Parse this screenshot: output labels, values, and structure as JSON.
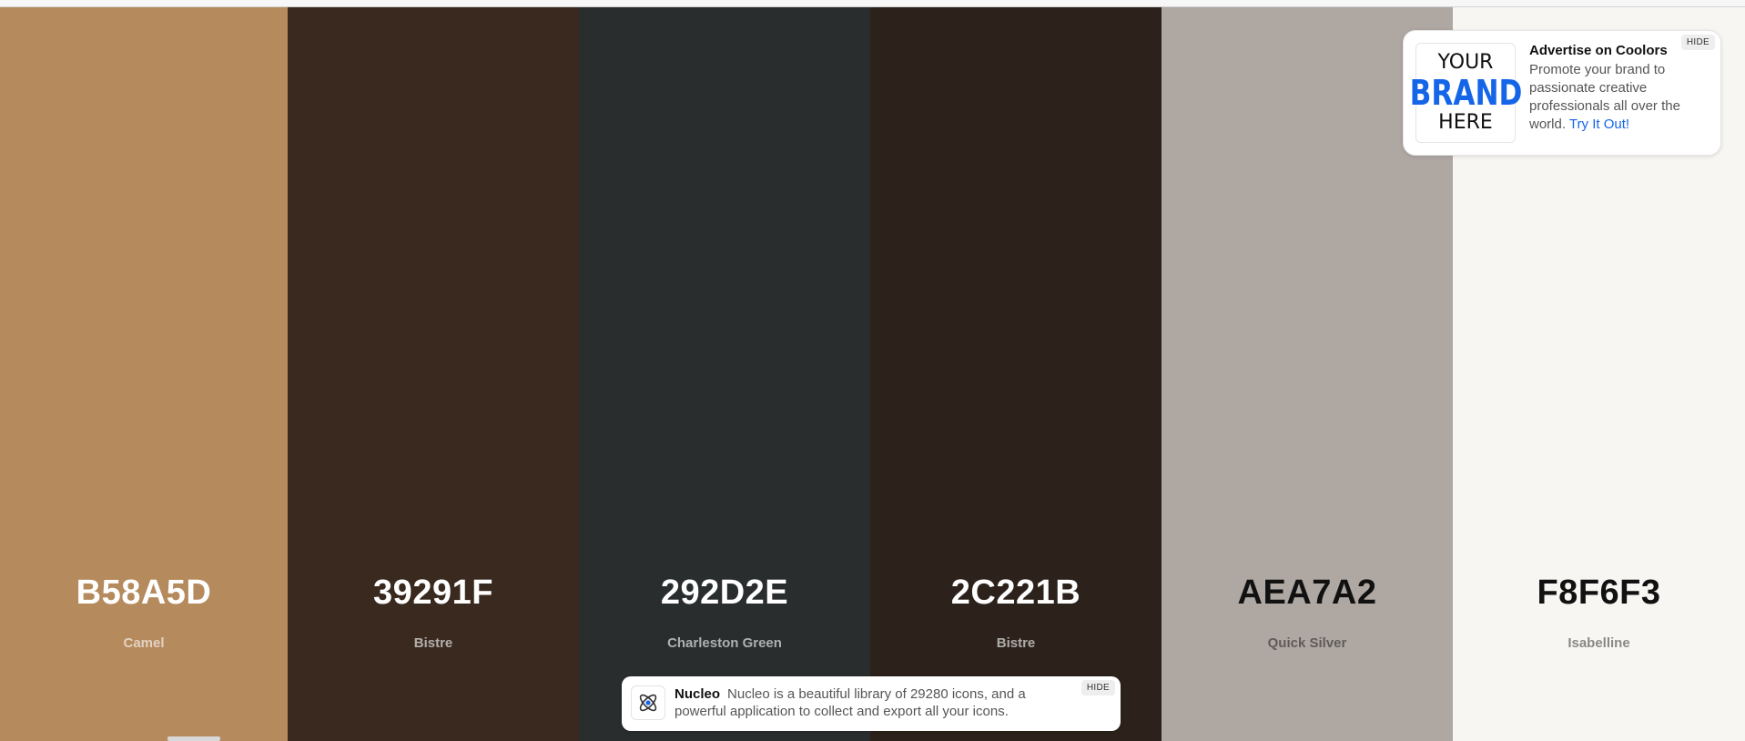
{
  "palette": {
    "colors": [
      {
        "hex": "B58A5D",
        "name": "Camel",
        "color": "#B58A5D",
        "text_theme": "light"
      },
      {
        "hex": "39291F",
        "name": "Bistre",
        "color": "#39291F",
        "text_theme": "light"
      },
      {
        "hex": "292D2E",
        "name": "Charleston Green",
        "color": "#292D2E",
        "text_theme": "light"
      },
      {
        "hex": "2C221B",
        "name": "Bistre",
        "color": "#2C221B",
        "text_theme": "light"
      },
      {
        "hex": "AEA7A2",
        "name": "Quick Silver",
        "color": "#AEA7A2",
        "text_theme": "dark"
      },
      {
        "hex": "F8F6F3",
        "name": "Isabelline",
        "color": "#F8F6F3",
        "text_theme": "dark"
      }
    ]
  },
  "ad": {
    "logo_line1": "YOUR",
    "logo_line2": "BRAND",
    "logo_line3": "HERE",
    "title": "Advertise on Coolors",
    "body": "Promote your brand to passionate creative professionals all over the world.",
    "link": "Try It Out!",
    "hide_label": "HIDE",
    "accent_color": "#1565E8"
  },
  "banner": {
    "icon": "atom-icon",
    "title": "Nucleo",
    "body": "Nucleo is a beautiful library of 29280 icons, and a powerful application to collect and export all your icons.",
    "hide_label": "HIDE"
  }
}
